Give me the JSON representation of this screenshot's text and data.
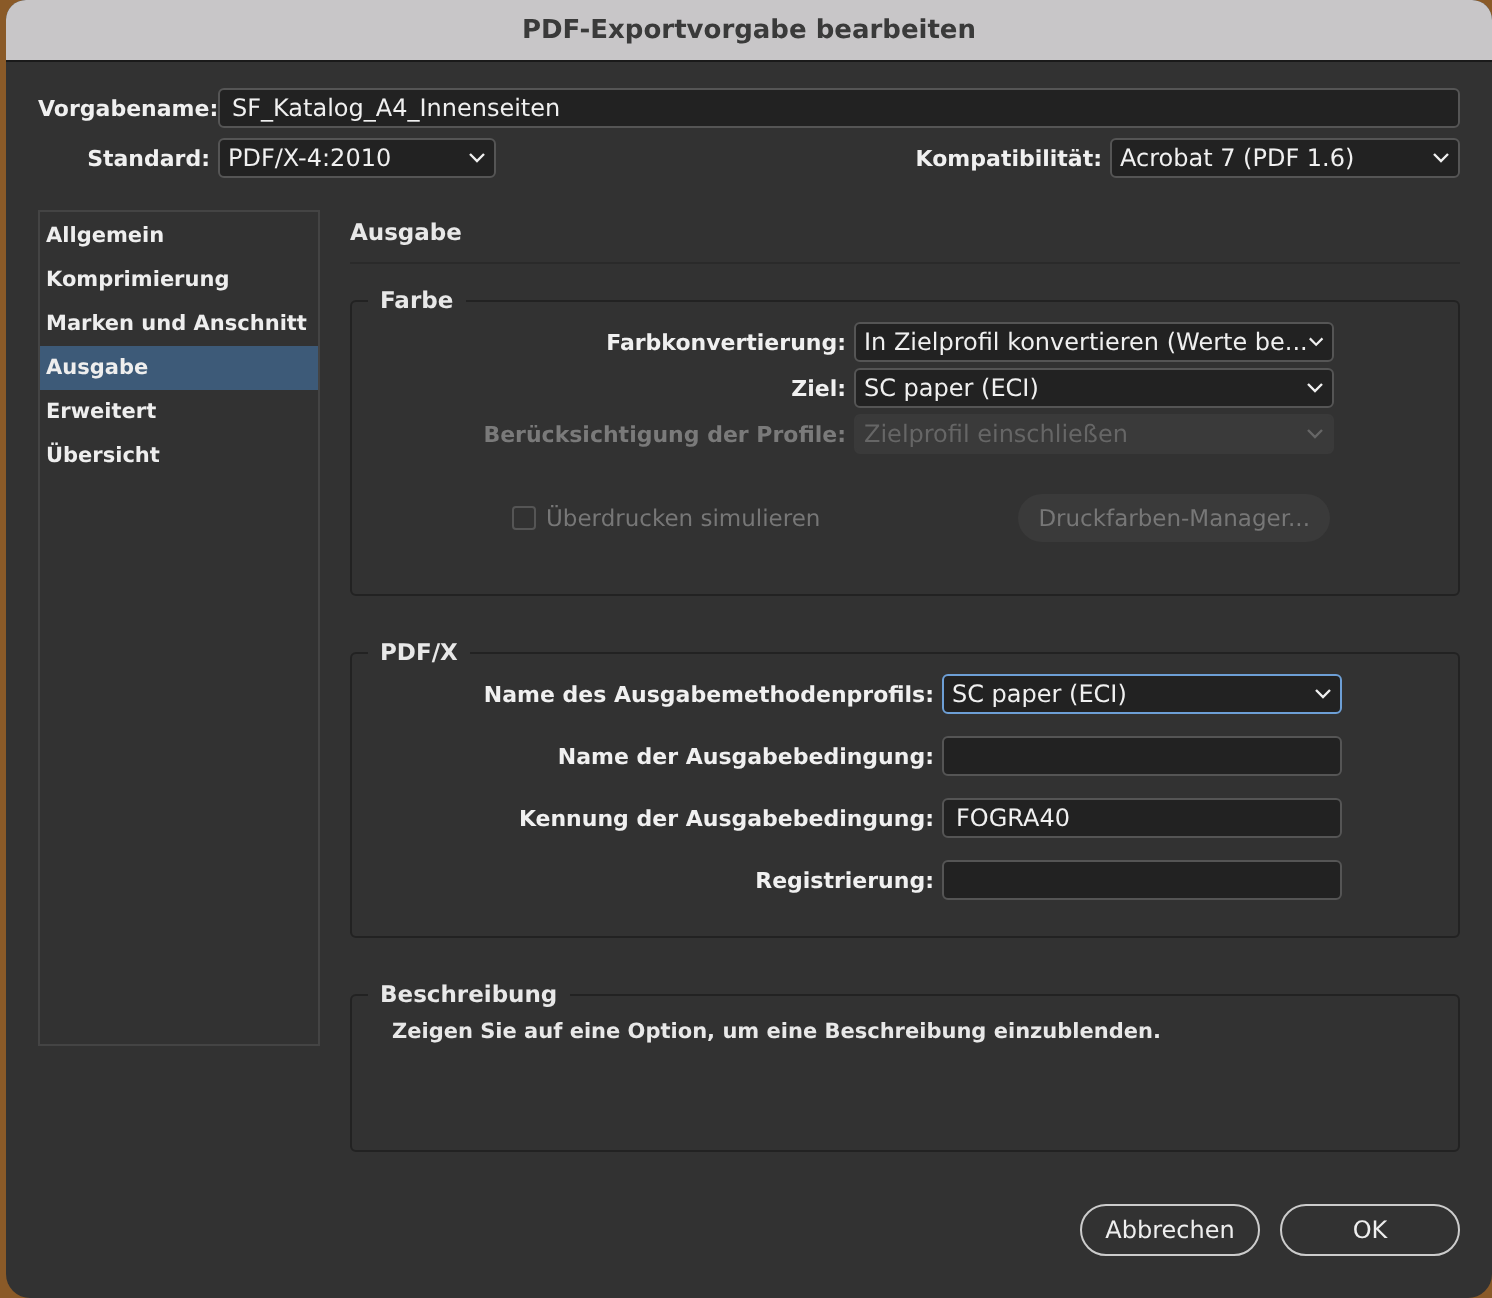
{
  "window": {
    "title": "PDF-Exportvorgabe bearbeiten"
  },
  "preset_name": {
    "label": "Vorgabename:",
    "value": "SF_Katalog_A4_Innenseiten"
  },
  "standard": {
    "label": "Standard:",
    "value": "PDF/X-4:2010"
  },
  "compatibility": {
    "label": "Kompatibilität:",
    "value": "Acrobat 7 (PDF 1.6)"
  },
  "sidebar": {
    "items": [
      {
        "label": "Allgemein",
        "selected": false
      },
      {
        "label": "Komprimierung",
        "selected": false
      },
      {
        "label": "Marken und Anschnitt",
        "selected": false
      },
      {
        "label": "Ausgabe",
        "selected": true
      },
      {
        "label": "Erweitert",
        "selected": false
      },
      {
        "label": "Übersicht",
        "selected": false
      }
    ]
  },
  "section_title": "Ausgabe",
  "color_group": {
    "title": "Farbe",
    "fields": [
      {
        "label": "Farbkonvertierung:",
        "value": "In Zielprofil konvertieren (Werte be...",
        "disabled": false
      },
      {
        "label": "Ziel:",
        "value": "SC paper (ECI)",
        "disabled": false
      },
      {
        "label": "Berücksichtigung der Profile:",
        "value": "Zielprofil einschließen",
        "disabled": true
      }
    ],
    "checkbox": {
      "label": "Überdrucken simulieren",
      "checked": false,
      "disabled": true
    },
    "button": {
      "label": "Druckfarben-Manager...",
      "disabled": true
    }
  },
  "pdfx_group": {
    "title": "PDF/X",
    "fields": [
      {
        "kind": "select",
        "label": "Name des Ausgabemethodenprofils:",
        "value": "SC paper (ECI)",
        "focused": true
      },
      {
        "kind": "text",
        "label": "Name der Ausgabebedingung:",
        "focused": false
      },
      {
        "kind": "text",
        "label": "Kennung der Ausgabebedingung:",
        "value": "FOGRA40",
        "focused": false
      },
      {
        "kind": "text",
        "label": "Registrierung:",
        "focused": false
      }
    ]
  },
  "description_group": {
    "title": "Beschreibung",
    "text": "Zeigen Sie auf eine Option, um eine Beschreibung einzublenden."
  },
  "buttons": [
    "Abbrechen",
    "OK"
  ]
}
